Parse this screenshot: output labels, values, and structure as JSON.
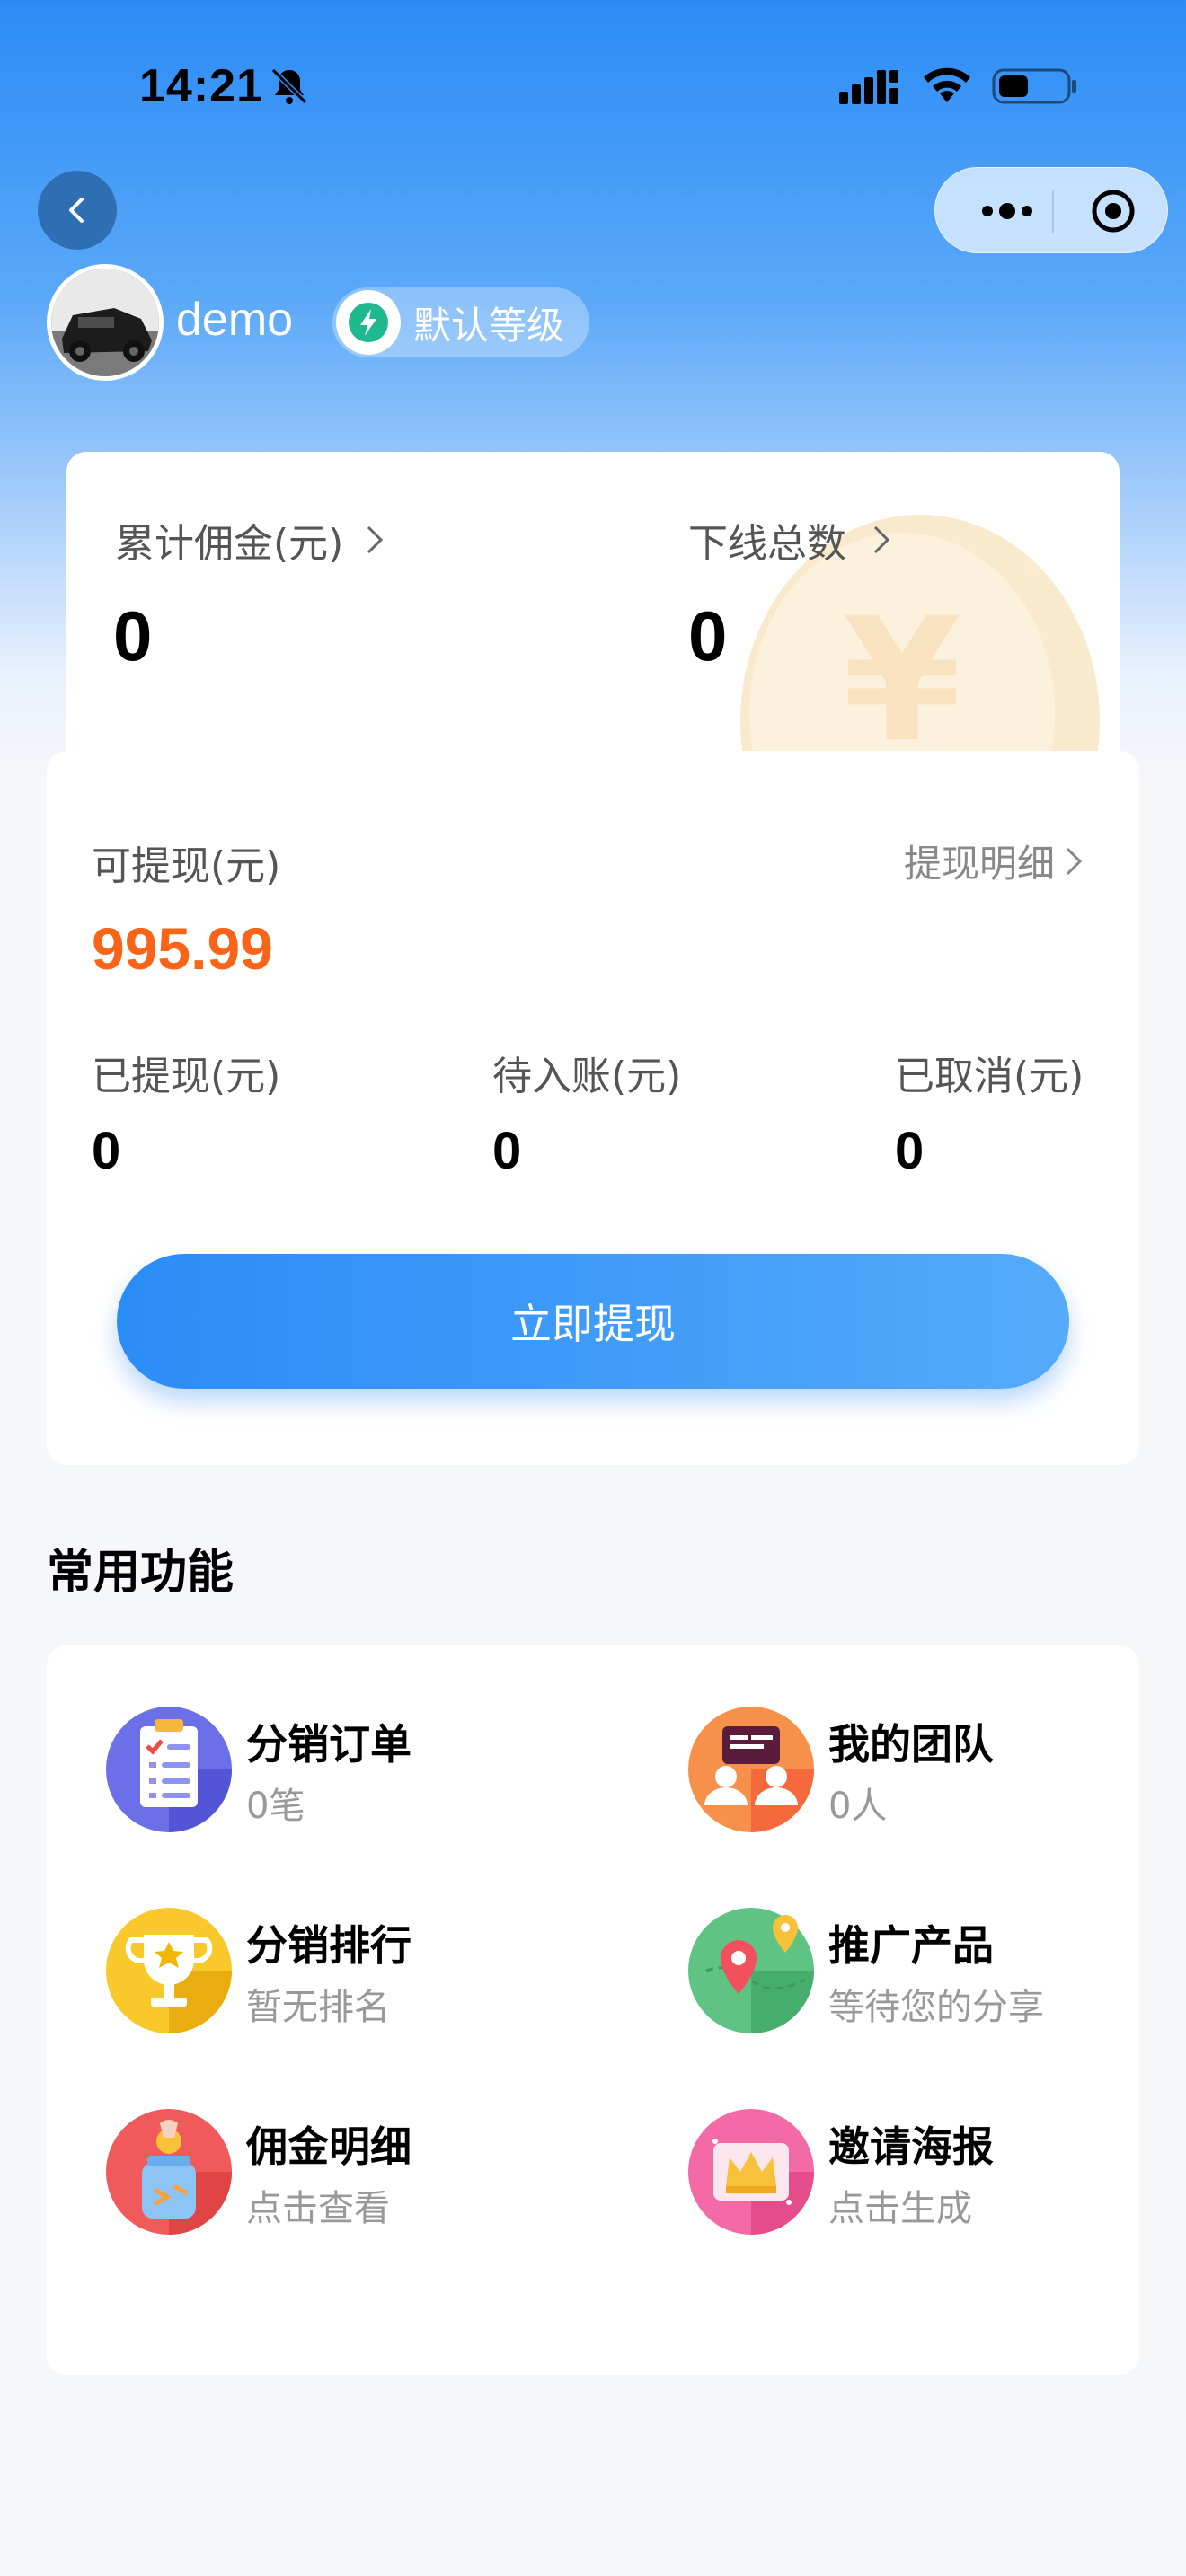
{
  "status_bar": {
    "time": "14:21"
  },
  "user": {
    "name": "demo",
    "level": "默认等级"
  },
  "summary": {
    "commission_label": "累计佣金(元)",
    "commission_value": "0",
    "downline_label": "下线总数",
    "downline_value": "0"
  },
  "wallet": {
    "available_label": "可提现(元)",
    "available_value": "995.99",
    "detail_link": "提现明细",
    "withdrawn_label": "已提现(元)",
    "withdrawn_value": "0",
    "pending_label": "待入账(元)",
    "pending_value": "0",
    "cancelled_label": "已取消(元)",
    "cancelled_value": "0",
    "withdraw_button": "立即提现"
  },
  "functions": {
    "title": "常用功能",
    "items": [
      {
        "title": "分销订单",
        "sub": "0笔",
        "icon": "order-list-icon"
      },
      {
        "title": "我的团队",
        "sub": "0人",
        "icon": "team-icon"
      },
      {
        "title": "分销排行",
        "sub": "暂无排名",
        "icon": "trophy-icon"
      },
      {
        "title": "推广产品",
        "sub": "等待您的分享",
        "icon": "map-pin-icon"
      },
      {
        "title": "佣金明细",
        "sub": "点击查看",
        "icon": "coin-jar-icon"
      },
      {
        "title": "邀请海报",
        "sub": "点击生成",
        "icon": "crown-poster-icon"
      }
    ]
  },
  "colors": {
    "accent": "#2a8cf6",
    "amount": "#fa6418"
  }
}
